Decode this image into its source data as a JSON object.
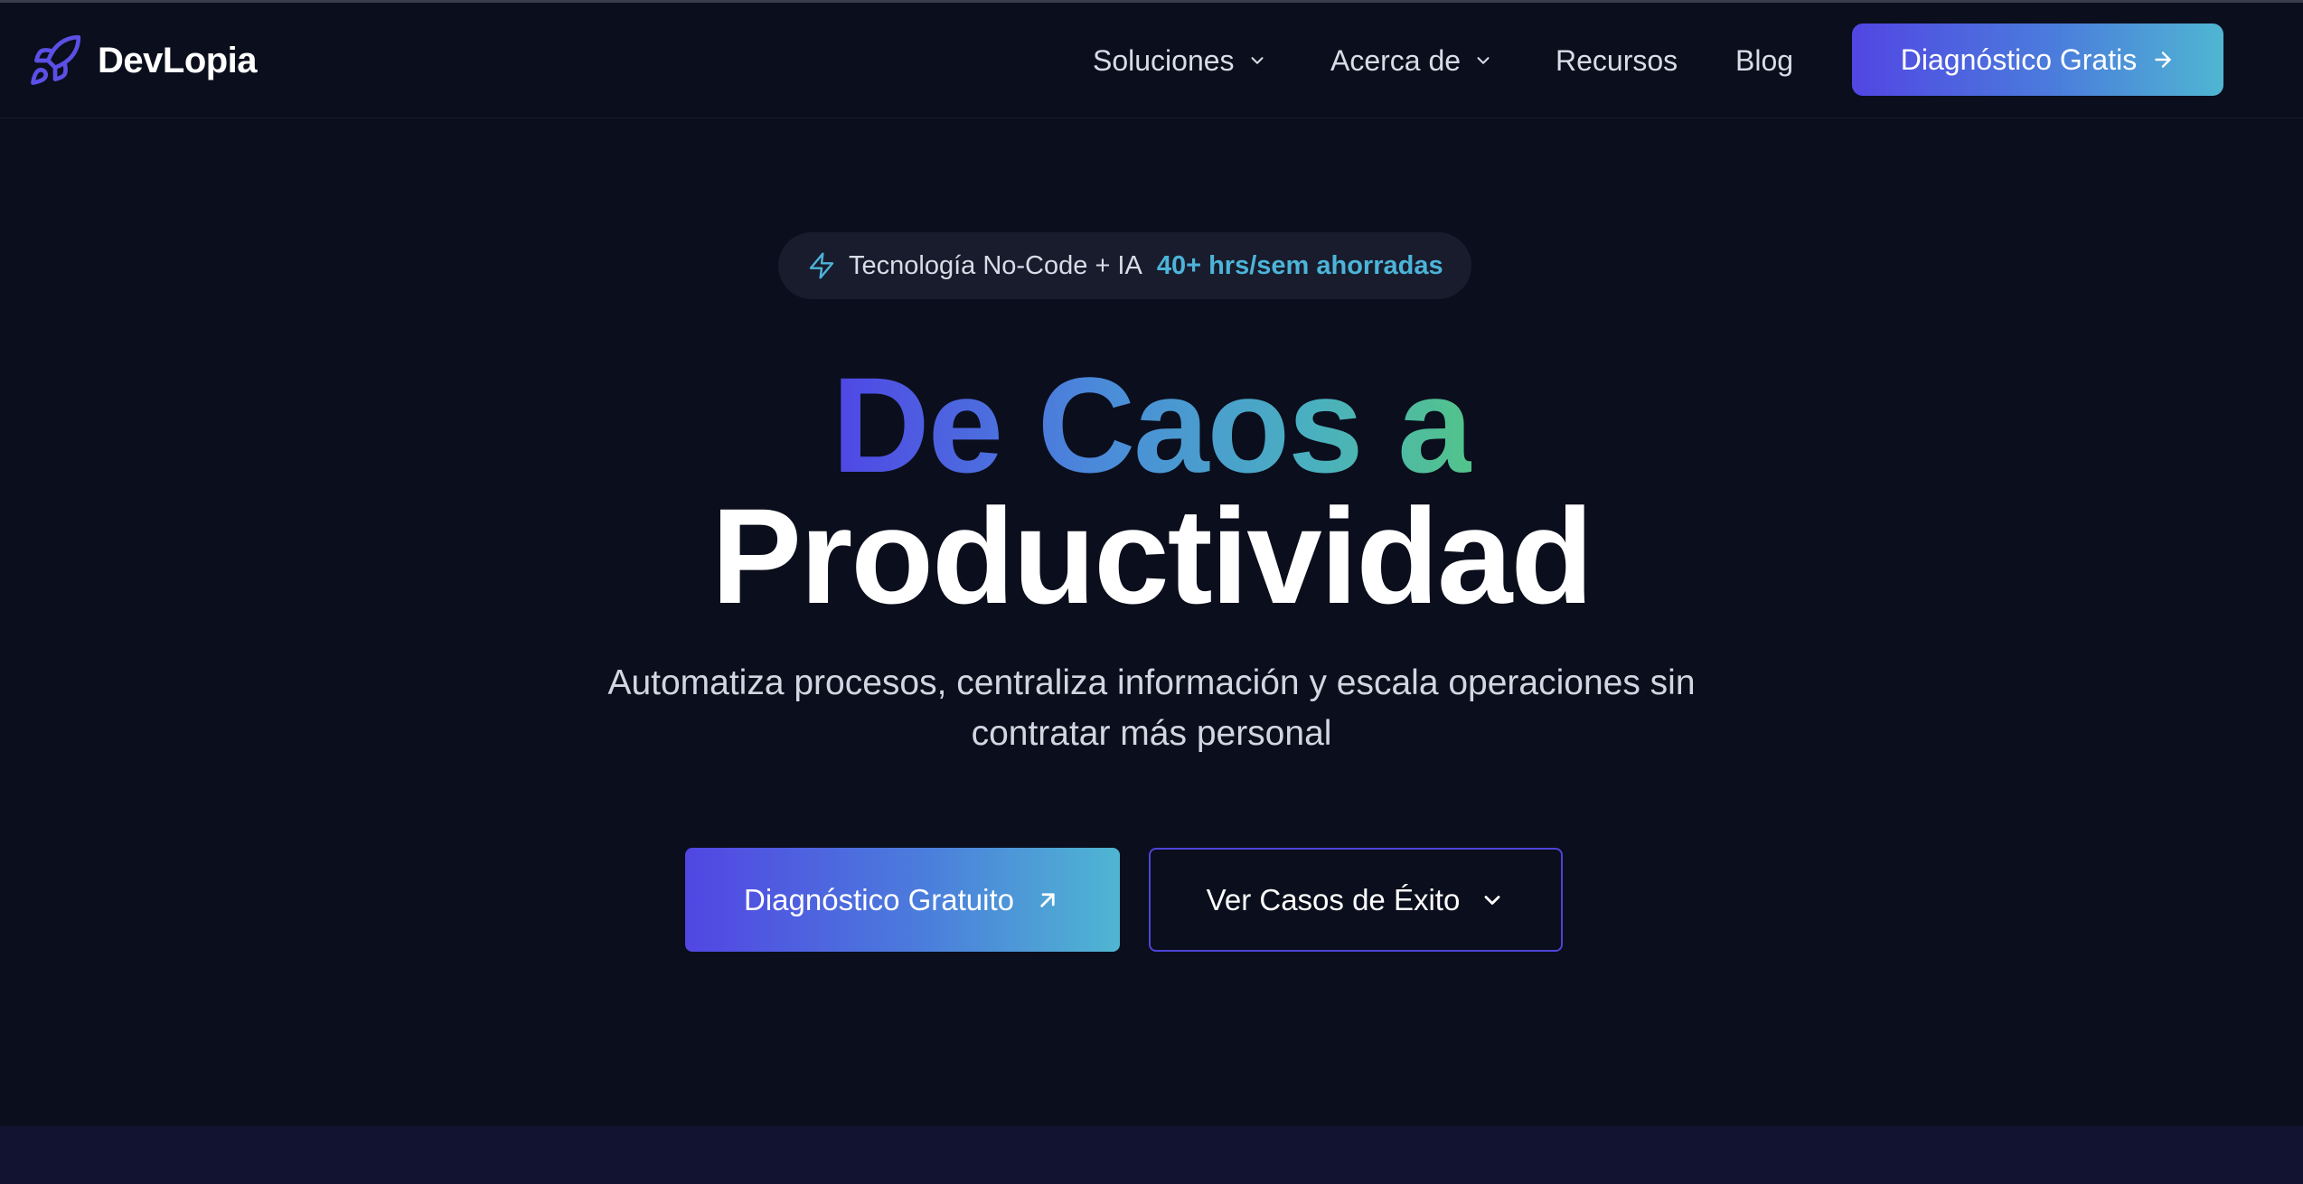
{
  "brand": {
    "name": "DevLopia",
    "icon": "rocket-icon"
  },
  "nav": {
    "items": [
      {
        "label": "Soluciones",
        "has_dropdown": true
      },
      {
        "label": "Acerca de",
        "has_dropdown": true
      },
      {
        "label": "Recursos",
        "has_dropdown": false
      },
      {
        "label": "Blog",
        "has_dropdown": false
      }
    ],
    "cta": {
      "label": "Diagnóstico Gratis",
      "icon": "arrow-right-icon"
    }
  },
  "hero": {
    "badge": {
      "icon": "bolt-icon",
      "text": "Tecnología No-Code + IA",
      "highlight": "40+ hrs/sem ahorradas"
    },
    "headline_gradient": "De Caos a",
    "headline_main": "Productividad",
    "subtitle": "Automatiza procesos, centraliza información y escala operaciones sin contratar más personal",
    "primary_button": {
      "label": "Diagnóstico Gratuito",
      "icon": "arrow-up-right-icon"
    },
    "secondary_button": {
      "label": "Ver Casos de Éxito",
      "icon": "chevron-down-icon"
    }
  },
  "colors": {
    "background": "#0b0e1c",
    "accent_start": "#5146e3",
    "accent_end": "#4fb6d2",
    "badge_highlight": "#4cb4d8",
    "headline_gradient_end": "#52c48a",
    "bottom_band": "#111331"
  }
}
